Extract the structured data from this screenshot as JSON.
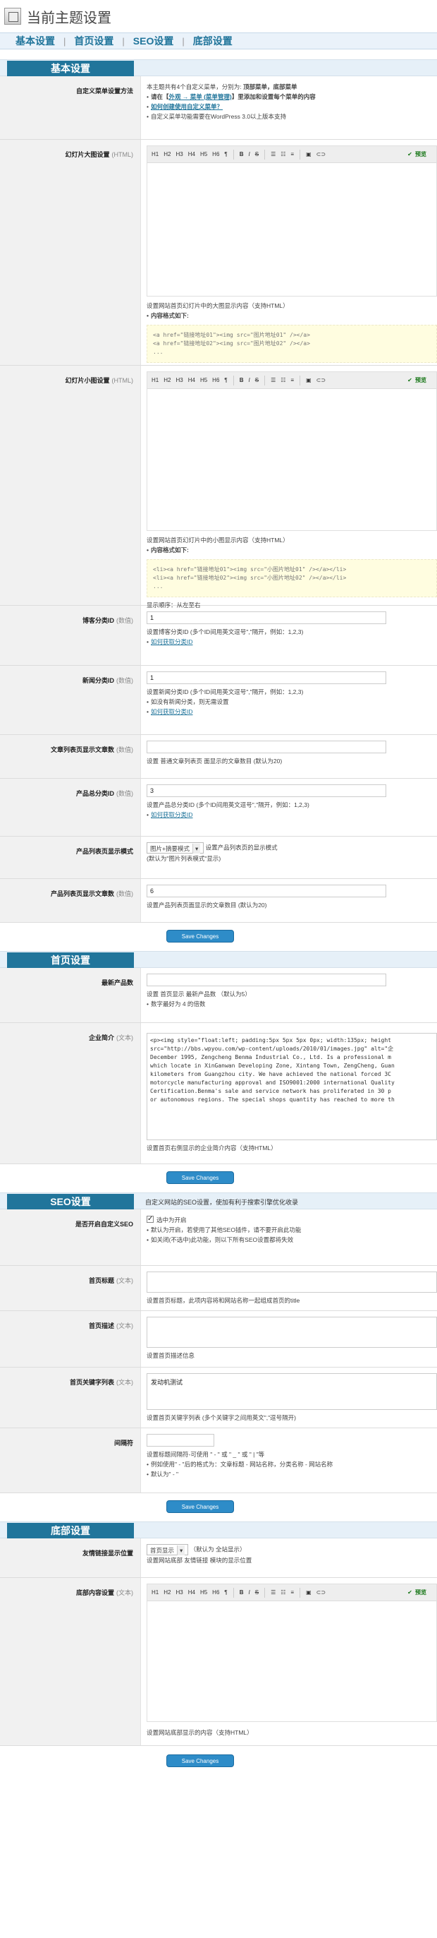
{
  "page": {
    "title": "当前主题设置"
  },
  "tabs": [
    {
      "label": "基本设置"
    },
    {
      "label": "首页设置"
    },
    {
      "label": "SEO设置"
    },
    {
      "label": "底部设置"
    }
  ],
  "separators": [
    "|",
    "|",
    "|"
  ],
  "save_label": "Save Changes",
  "editor_toolbar": {
    "h1": "H1",
    "h2": "H2",
    "h3": "H3",
    "h4": "H4",
    "h5": "H5",
    "h6": "H6",
    "preview": "预览"
  },
  "basic": {
    "header": "基本设置",
    "menu": {
      "label": "自定义菜单设置方法",
      "intro": "本主题共有4个自定义菜单，分别为:",
      "intro_bold": "顶部菜单，底部菜单",
      "step1_pre": "请在【",
      "step1_link": "外观 → 菜单 (菜单管理)",
      "step1_post": "】里添加和设置每个菜单的内容",
      "step2_link": "如何创建使用自定义菜单？",
      "note": "自定义菜单功能需要在WordPress 3.0以上版本支持"
    },
    "slider_big": {
      "label": "幻灯片大图设置",
      "hint": "(HTML)",
      "help": "设置网站首页幻灯片中的大图显示内容（支持HTML）",
      "format_title": "内容格式如下:",
      "code": [
        "<a href=\"链接地址01\"><img src=\"图片地址01\" /></a>",
        "<a href=\"链接地址02\"><img src=\"图片地址02\" /></a>",
        "..."
      ]
    },
    "slider_small": {
      "label": "幻灯片小图设置",
      "hint": "(HTML)",
      "help": "设置网站首页幻灯片中的小图显示内容（支持HTML）",
      "format_title": "内容格式如下:",
      "code": [
        "<li><a href=\"链接地址01\"><img src=\"小图片地址01\" /></a></li>",
        "<li><a href=\"链接地址02\"><img src=\"小图片地址02\" /></a></li>",
        "..."
      ],
      "order": "显示顺序：从左至右"
    },
    "blog_cat": {
      "label": "博客分类ID",
      "hint": "(数值)",
      "value": "1",
      "help": "设置博客分类ID (多个ID间用英文逗号\",\"隔开，例如：1,2,3)",
      "link": "如何获取分类ID"
    },
    "news_cat": {
      "label": "新闻分类ID",
      "hint": "(数值)",
      "value": "1",
      "help": "设置新闻分类ID (多个ID间用英文逗号\",\"隔开，例如：1,2,3)",
      "note": "如没有新闻分类，则无需设置",
      "link": "如何获取分类ID"
    },
    "list_count": {
      "label": "文章列表页显示文章数",
      "hint": "(数值)",
      "value": "",
      "help": "设置 普通文章列表页 面显示的文章数目 (默认为20)"
    },
    "product_cat": {
      "label": "产品总分类ID",
      "hint": "(数值)",
      "value": "3",
      "help": "设置产品总分类ID (多个ID间用英文逗号\",\"隔开，例如：1,2,3)",
      "link": "如何获取分类ID"
    },
    "product_mode": {
      "label": "产品列表页显示模式",
      "selected": "图片+摘要模式",
      "help": "设置产品列表页的显示模式",
      "default": "(默认为\"图片列表模式\"显示)"
    },
    "product_count": {
      "label": "产品列表页显示文章数",
      "hint": "(数值)",
      "value": "6",
      "help": "设置产品列表页面显示的文章数目 (默认为20)"
    }
  },
  "home": {
    "header": "首页设置",
    "latest": {
      "label": "最新产品数",
      "value": "",
      "help": "设置 首页显示 最新产品数 （默认为5）",
      "note": "数字最好为 4 的倍数"
    },
    "intro": {
      "label": "企业简介",
      "hint": "(文本)",
      "content": [
        "<p><img style=\"float:left; padding:5px 5px 5px 0px; width:135px; height",
        "src=\"http://bbs.wpyou.com/wp-content/uploads/2010/01/images.jpg\" alt=\"企",
        "December 1995, Zengcheng Benma Industrial Co., Ltd. Is a professional m",
        "which locate in XinGanwan Developing Zone, Xintang Town, ZengCheng, Guan",
        "kilometers from Guangzhou city. We have achieved the national forced 3C",
        "motorcycle manufacturing approval and ISO9001:2000 international Quality",
        "Certification.Benma's sale and service network has proliferated in 30 p",
        "or autonomous regions. The special shops quantity has reached to more th"
      ],
      "help": "设置首页右侧显示的企业简介内容（支持HTML）"
    }
  },
  "seo": {
    "header": "SEO设置",
    "desc": "自定义网站的SEO设置，使加有利于搜索引擎优化收录",
    "custom": {
      "label": "是否开启自定义SEO",
      "check_label": "选中为开启",
      "note1": "默认为开启，若使用了其他SEO插件，请不要开启此功能",
      "note2": "如关闭(不选中)此功能，则以下所有SEO设置都将失效"
    },
    "home_title": {
      "label": "首页标题",
      "hint": "(文本)",
      "help": "设置首页标题，此项内容将和网站名称一起组成首页的title"
    },
    "home_desc": {
      "label": "首页描述",
      "hint": "(文本)",
      "help": "设置首页描述信息"
    },
    "keywords": {
      "label": "首页关键字列表",
      "hint": "(文本)",
      "value": "发动机测试",
      "help": "设置首页关键字列表 (多个关键字之间用英文\",\"逗号隔开)"
    },
    "separator": {
      "label": "间隔符",
      "help": "设置标题间隔符-可使用 \" - \" 或 \" _ \" 或 \" | \"等",
      "example": "例如使用\" - \"后的格式为：文章标题 - 网站名称，分类名称 - 网站名称",
      "default": "默认为\" - \""
    }
  },
  "footer": {
    "header": "底部设置",
    "links": {
      "label": "友情链接显示位置",
      "selected": "首页显示",
      "default": "（默认为 全站显示）",
      "help": "设置网站底部 友情链接 模块的显示位置"
    },
    "content": {
      "label": "底部内容设置",
      "hint": "(文本)",
      "help": "设置网站底部显示的内容（支持HTML）"
    }
  }
}
